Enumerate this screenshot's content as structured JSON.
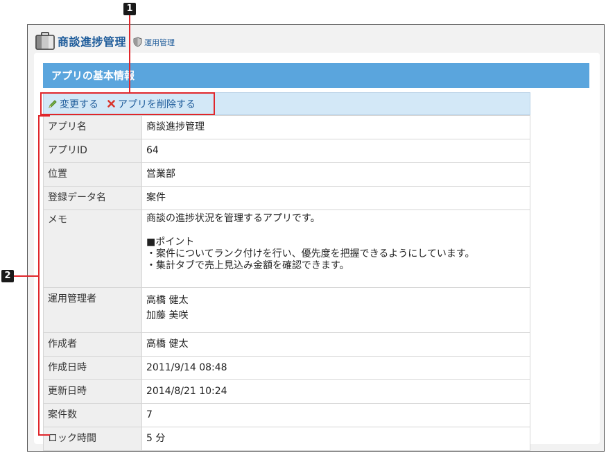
{
  "header": {
    "title": "商談進捗管理",
    "admin_link": "運用管理"
  },
  "section": {
    "title": "アプリの基本情報"
  },
  "toolbar": {
    "edit_label": "変更する",
    "delete_label": "アプリを削除する"
  },
  "info": {
    "app_name": {
      "label": "アプリ名",
      "value": "商談進捗管理"
    },
    "app_id": {
      "label": "アプリID",
      "value": "64"
    },
    "location": {
      "label": "位置",
      "value": "営業部"
    },
    "data_name": {
      "label": "登録データ名",
      "value": "案件"
    },
    "memo": {
      "label": "メモ",
      "lines": [
        "商談の進捗状況を管理するアプリです。",
        "■ポイント",
        "・案件についてランク付けを行い、優先度を把握できるようにしています。",
        "・集計タブで売上見込み金額を確認できます。"
      ]
    },
    "admins": {
      "label": "運用管理者",
      "values": [
        "高橋 健太",
        "加藤 美咲"
      ]
    },
    "creator": {
      "label": "作成者",
      "value": "高橋 健太"
    },
    "created_at": {
      "label": "作成日時",
      "value": "2011/9/14 08:48"
    },
    "updated_at": {
      "label": "更新日時",
      "value": "2014/8/21 10:24"
    },
    "record_count": {
      "label": "案件数",
      "value": "7"
    },
    "lock_time": {
      "label": "ロック時間",
      "value": "5 分"
    }
  },
  "callouts": {
    "one": "1",
    "two": "2"
  },
  "colors": {
    "accent_blue": "#5aa5dd",
    "link_blue": "#1d5b9a",
    "toolbar_bg": "#d3e8f7",
    "callout_red": "#e0262b"
  },
  "icons": {
    "app": "briefcase-icon",
    "admin": "shield-icon",
    "edit": "pencil-icon",
    "delete": "x-icon"
  }
}
